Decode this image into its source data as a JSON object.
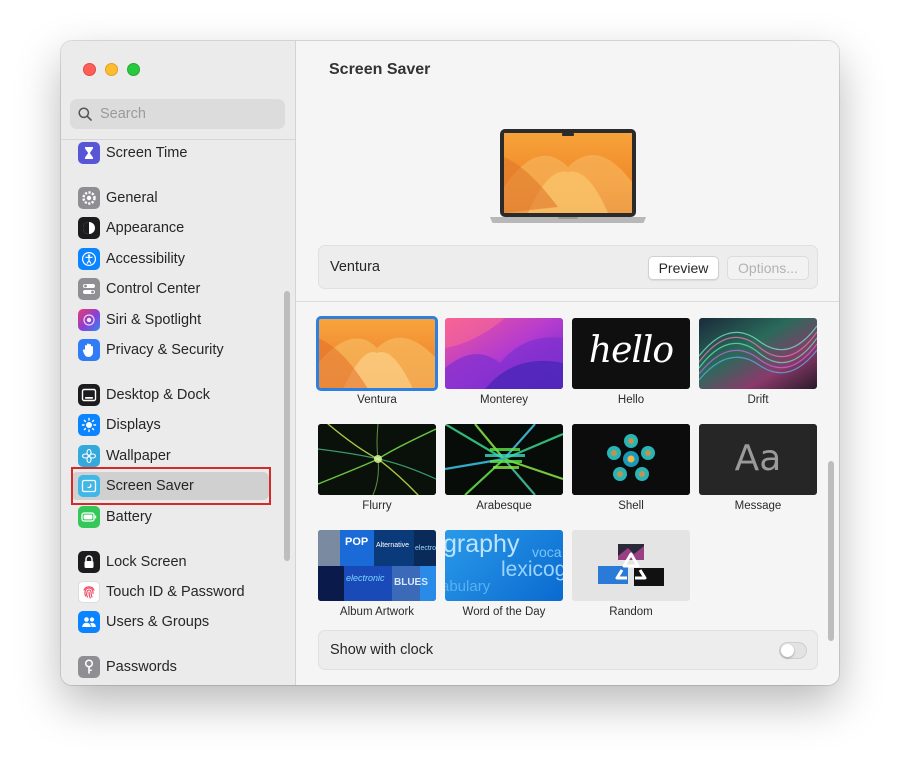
{
  "window": {
    "title": "Screen Saver"
  },
  "search": {
    "placeholder": "Search"
  },
  "sidebar": {
    "items": [
      {
        "label": "Screen Time",
        "icon": "hourglass-icon",
        "color": "#5856d6"
      },
      {
        "label": "General",
        "icon": "gear-icon",
        "color": "#8e8e93"
      },
      {
        "label": "Appearance",
        "icon": "appearance-icon",
        "color": "#1c1c1e"
      },
      {
        "label": "Accessibility",
        "icon": "accessibility-icon",
        "color": "#0a84ff"
      },
      {
        "label": "Control Center",
        "icon": "control-center-icon",
        "color": "#8e8e93"
      },
      {
        "label": "Siri & Spotlight",
        "icon": "siri-icon",
        "color": "#b04ad4"
      },
      {
        "label": "Privacy & Security",
        "icon": "hand-icon",
        "color": "#2f7cf6"
      },
      {
        "label": "Desktop & Dock",
        "icon": "desktop-dock-icon",
        "color": "#1c1c1e"
      },
      {
        "label": "Displays",
        "icon": "sun-icon",
        "color": "#0a84ff"
      },
      {
        "label": "Wallpaper",
        "icon": "flower-icon",
        "color": "#34aadc"
      },
      {
        "label": "Screen Saver",
        "icon": "screen-saver-icon",
        "color": "#3fb8e8",
        "selected": true
      },
      {
        "label": "Battery",
        "icon": "battery-icon",
        "color": "#34c759"
      },
      {
        "label": "Lock Screen",
        "icon": "lock-icon",
        "color": "#1c1c1e"
      },
      {
        "label": "Touch ID & Password",
        "icon": "fingerprint-icon",
        "color": "#ffffff"
      },
      {
        "label": "Users & Groups",
        "icon": "users-icon",
        "color": "#0a84ff"
      },
      {
        "label": "Passwords",
        "icon": "key-icon",
        "color": "#8e8e93"
      }
    ]
  },
  "main": {
    "title": "Screen Saver",
    "current_saver": "Ventura",
    "preview_label": "Preview",
    "options_label": "Options...",
    "savers": [
      {
        "label": "Ventura",
        "selected": true
      },
      {
        "label": "Monterey"
      },
      {
        "label": "Hello"
      },
      {
        "label": "Drift"
      },
      {
        "label": "Flurry"
      },
      {
        "label": "Arabesque"
      },
      {
        "label": "Shell"
      },
      {
        "label": "Message"
      },
      {
        "label": "Album Artwork"
      },
      {
        "label": "Word of the Day"
      },
      {
        "label": "Random"
      }
    ],
    "thumb_text": {
      "hello": "hello",
      "message": "Aa",
      "word_1": "graphy",
      "word_2": "voca",
      "word_3": "lexicog",
      "word_4": "abulary",
      "album_1": "POP",
      "album_2": "Alternative",
      "album_3": "electronic",
      "album_4": "BLUES",
      "album_5": "electro"
    },
    "clock_label": "Show with clock",
    "clock_enabled": false
  },
  "colors": {
    "accent": "#2c7fe3",
    "highlight_box": "#d62a2a"
  }
}
